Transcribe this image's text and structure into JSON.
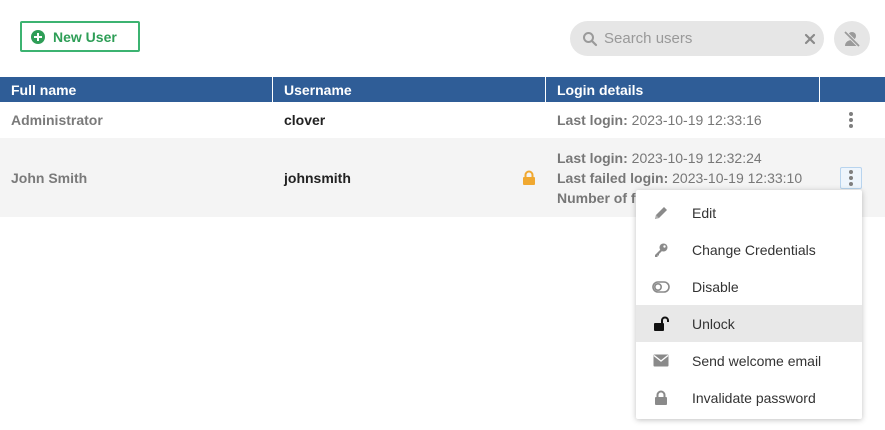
{
  "toolbar": {
    "new_user_label": "New User",
    "search_placeholder": "Search users",
    "search_value": ""
  },
  "table": {
    "columns": [
      "Full name",
      "Username",
      "Login details",
      ""
    ],
    "rows": [
      {
        "full_name": "Administrator",
        "username": "clover",
        "login_lines": [
          {
            "label": "Last login:",
            "value": "2023-10-19 12:33:16"
          }
        ]
      },
      {
        "full_name": "John Smith",
        "username": "johnsmith",
        "locked": true,
        "login_lines": [
          {
            "label": "Last login:",
            "value": "2023-10-19 12:32:24"
          },
          {
            "label": "Last failed login:",
            "value": "2023-10-19 12:33:10"
          },
          {
            "label": "Number of f",
            "value": ""
          }
        ]
      }
    ]
  },
  "context_menu": {
    "items": [
      {
        "label": "Edit",
        "icon": "pencil-icon"
      },
      {
        "label": "Change Credentials",
        "icon": "key-icon"
      },
      {
        "label": "Disable",
        "icon": "toggle-icon"
      },
      {
        "label": "Unlock",
        "icon": "unlock-icon",
        "hovered": true
      },
      {
        "label": "Send welcome email",
        "icon": "envelope-icon"
      },
      {
        "label": "Invalidate password",
        "icon": "lock-icon"
      }
    ]
  },
  "colors": {
    "header_bg": "#2f5d97",
    "accent_green": "#2e9e57",
    "lock_orange": "#f0a830"
  }
}
